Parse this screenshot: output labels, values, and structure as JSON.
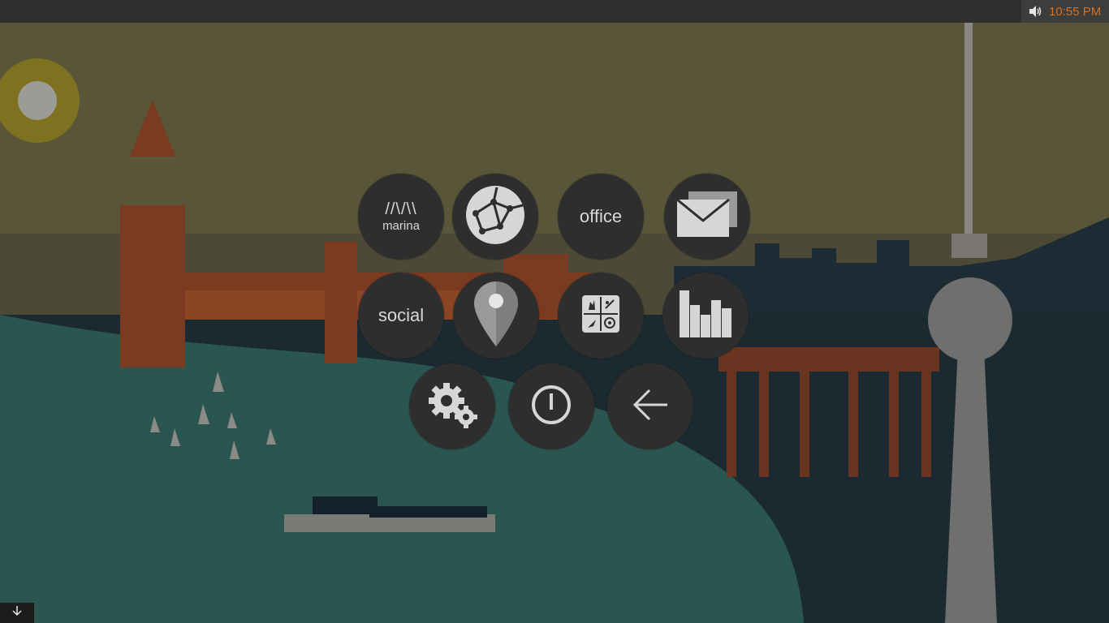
{
  "taskbar": {
    "time": "10:55 PM",
    "volume_icon": "speaker-icon",
    "accent": "#d8701e"
  },
  "launcher": {
    "items": [
      {
        "name": "marina",
        "mark": "//\\/\\\\",
        "label": "marina",
        "icon": "marina-logo-icon"
      },
      {
        "name": "browser",
        "icon": "globe-network-icon"
      },
      {
        "name": "office",
        "label": "office"
      },
      {
        "name": "mail",
        "icon": "envelope-icon"
      },
      {
        "name": "social",
        "label": "social"
      },
      {
        "name": "maps",
        "icon": "map-pin-icon"
      },
      {
        "name": "games",
        "icon": "games-grid-icon"
      },
      {
        "name": "charts",
        "icon": "bar-chart-icon"
      },
      {
        "name": "settings",
        "icon": "gears-icon"
      },
      {
        "name": "power",
        "icon": "power-icon"
      },
      {
        "name": "back",
        "icon": "arrow-left-icon"
      }
    ]
  },
  "bottom_button": {
    "icon": "arrow-down-icon"
  }
}
